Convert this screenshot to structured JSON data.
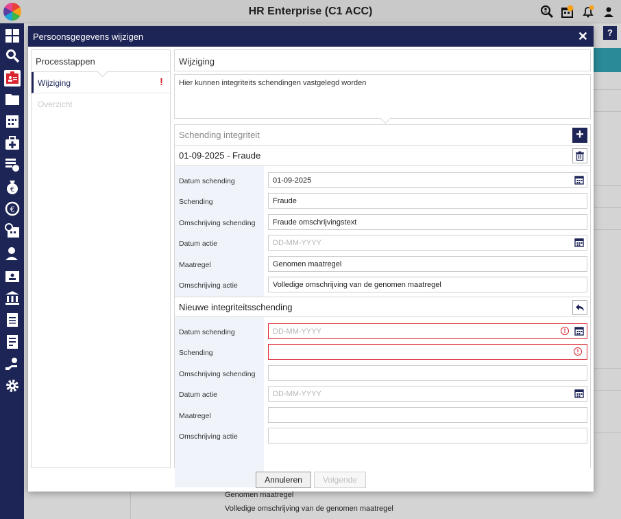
{
  "app": {
    "title": "HR Enterprise (C1 ACC)"
  },
  "topbar_icons": [
    "zoom-person-icon",
    "calendar-alert-icon",
    "bell-icon",
    "user-menu-icon"
  ],
  "rail_icons": [
    "grid-icon",
    "search-icon",
    "id-card-icon",
    "folder-icon",
    "calendar-icon",
    "medical-bag-icon",
    "checklist-icon",
    "money-bag-icon",
    "euro-coin-icon",
    "alarm-calendar-icon",
    "person-icon",
    "contact-card-icon",
    "bank-icon",
    "document-icon",
    "document-lines-icon",
    "hand-person-icon",
    "gear-icon"
  ],
  "background": {
    "help_label": "?",
    "lines": [
      "Genomen maatregel",
      "Volledige omschrijving van de genomen maatregel"
    ]
  },
  "modal": {
    "title": "Persoonsgegevens wijzigen",
    "close_label": "✕",
    "steps": {
      "heading": "Processtappen",
      "items": [
        {
          "label": "Wijziging",
          "alert": "!"
        },
        {
          "label": "Overzicht"
        }
      ]
    },
    "panel_title": "Wijziging",
    "description": "Hier kunnen integriteits schendingen vastgelegd worden",
    "section_title": "Schending integriteit",
    "add_label": "+",
    "existing": {
      "title": "01-09-2025 - Fraude",
      "fields": [
        {
          "label": "Datum schending",
          "value": "01-09-2025"
        },
        {
          "label": "Schending",
          "value": "Fraude"
        },
        {
          "label": "Omschrijving schending",
          "value": "Fraude omschrijvingstext"
        },
        {
          "label": "Datum actie",
          "placeholder": "DD-MM-YYYY"
        },
        {
          "label": "Maatregel",
          "value": "Genomen maatregel"
        },
        {
          "label": "Omschrijving actie",
          "value": "Volledige omschrijving van de genomen maatregel"
        }
      ]
    },
    "new_entry": {
      "title": "Nieuwe integriteitsschending",
      "fields": [
        {
          "label": "Datum schending",
          "placeholder": "DD-MM-YYYY"
        },
        {
          "label": "Schending",
          "value": ""
        },
        {
          "label": "Omschrijving schending",
          "value": ""
        },
        {
          "label": "Datum actie",
          "placeholder": "DD-MM-YYYY"
        },
        {
          "label": "Maatregel",
          "value": ""
        },
        {
          "label": "Omschrijving actie",
          "value": ""
        }
      ],
      "error_mark": "!"
    },
    "buttons": {
      "cancel": "Annuleren",
      "next": "Volgende"
    }
  },
  "colors": {
    "brand": "#1d2456",
    "error": "#d9232d",
    "teal": "#2a8a98"
  }
}
